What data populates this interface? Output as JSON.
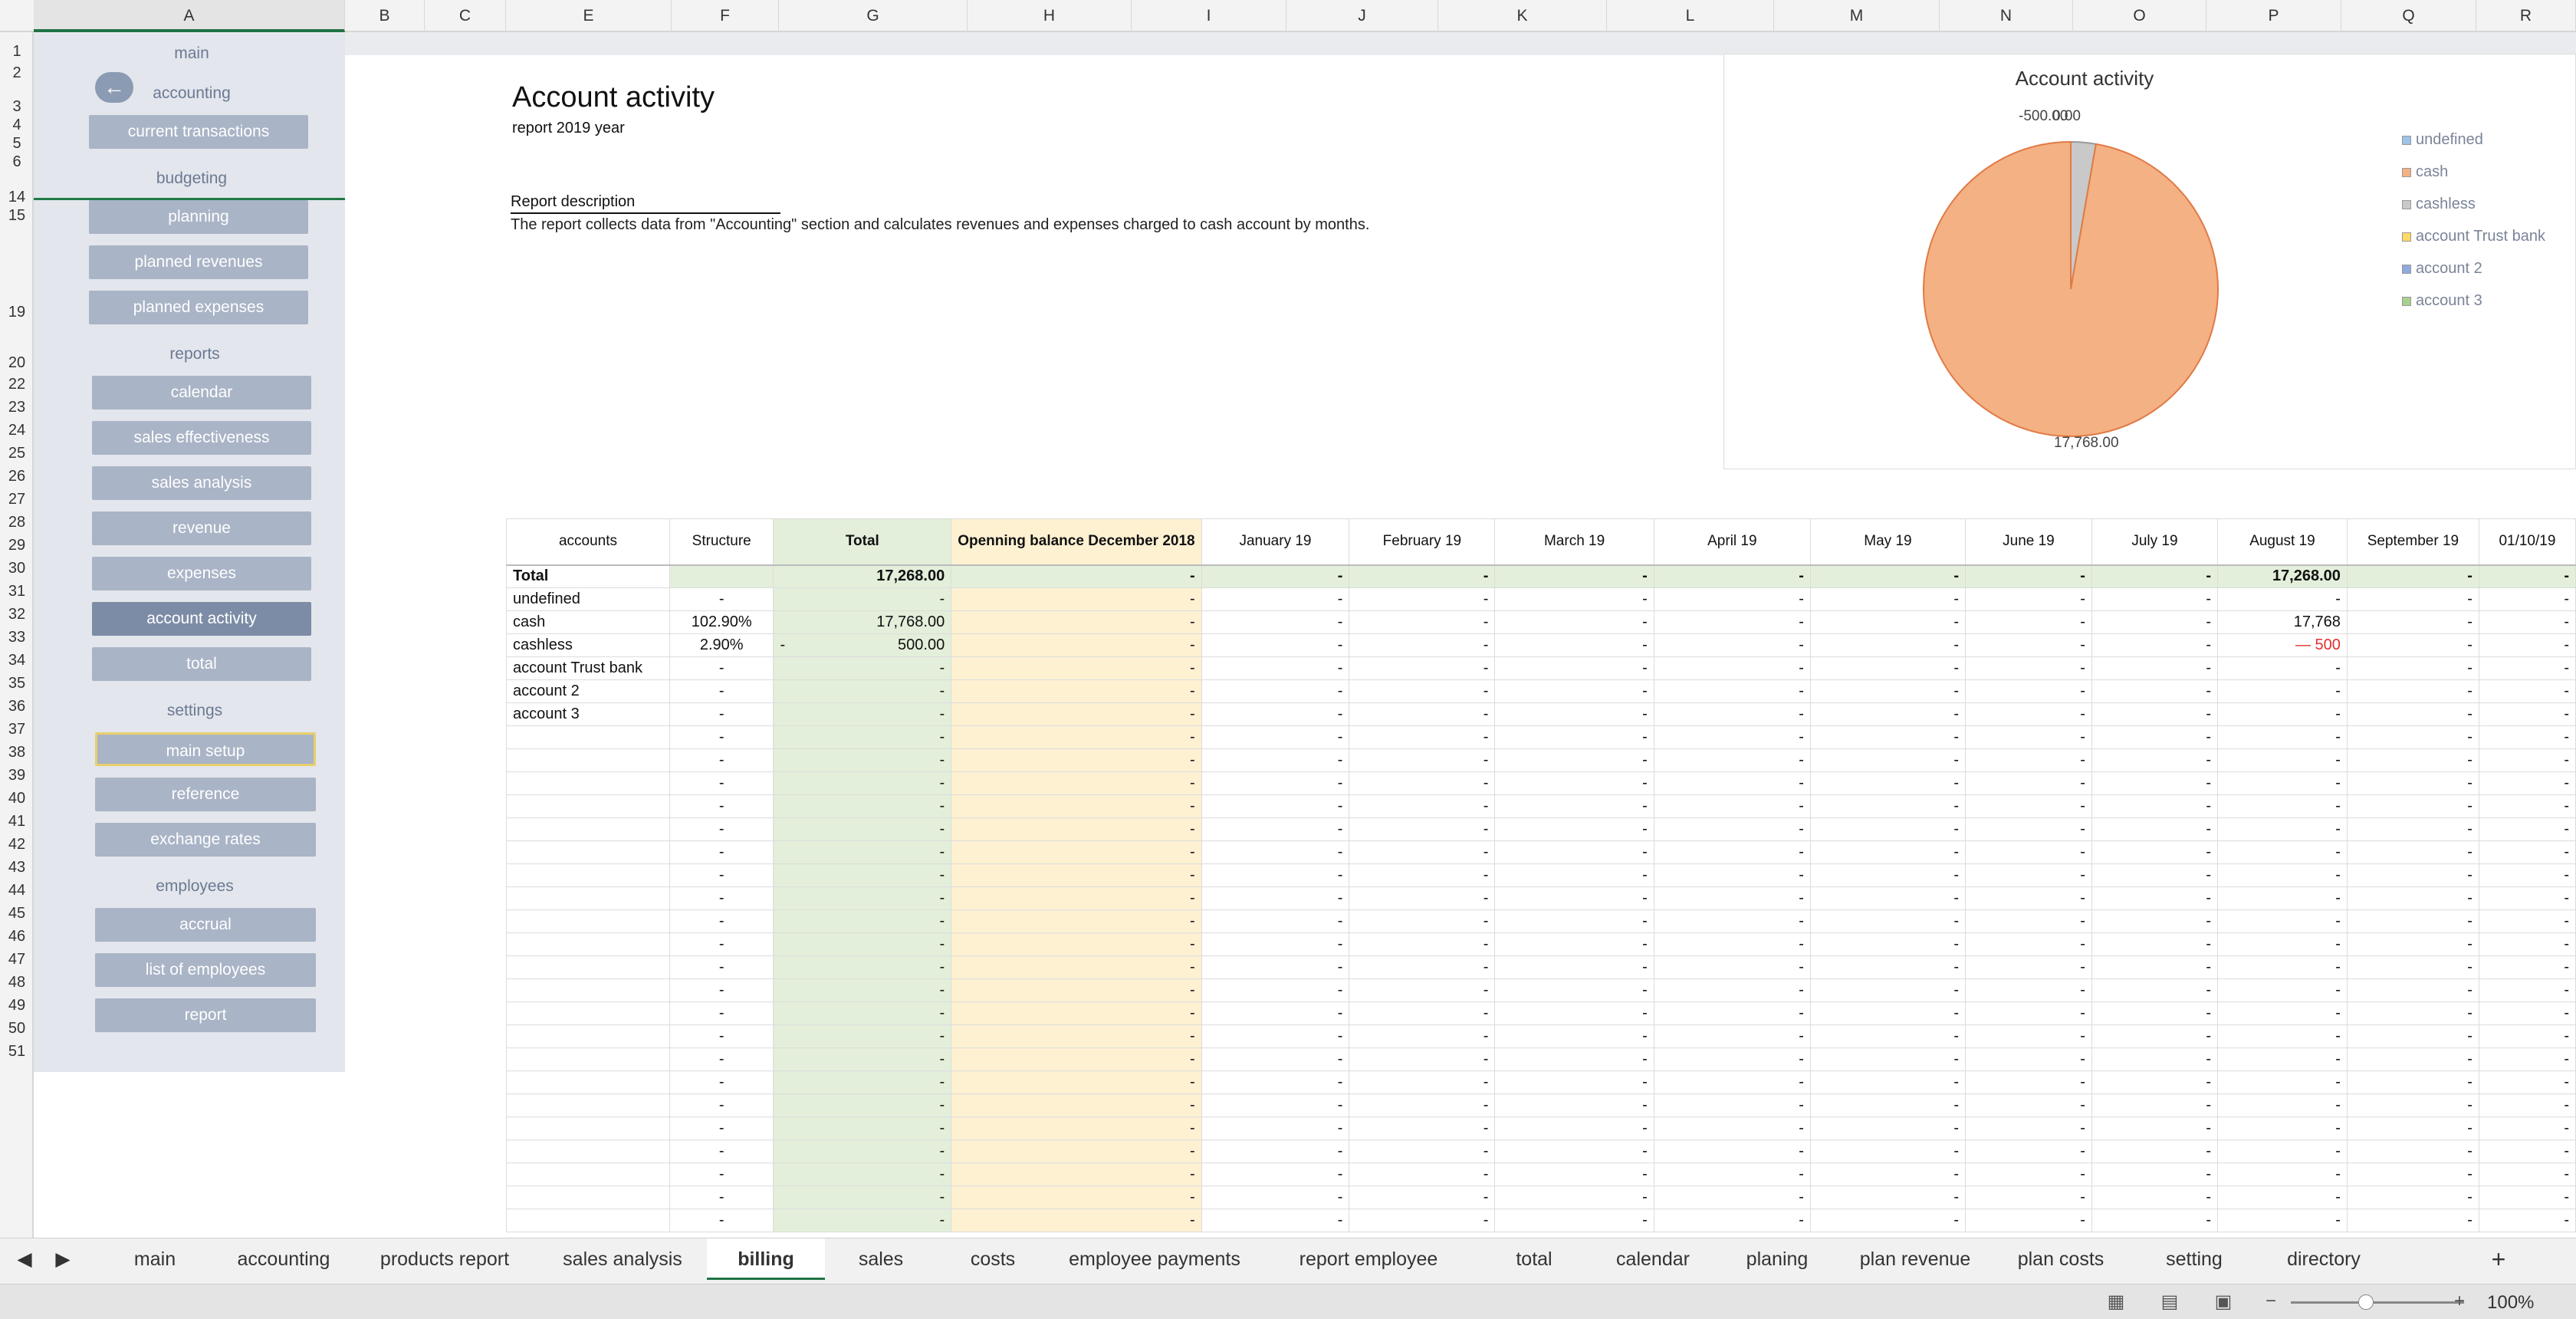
{
  "column_headers": [
    "A",
    "B",
    "C",
    "E",
    "F",
    "G",
    "H",
    "I",
    "J",
    "K",
    "L",
    "M",
    "N",
    "O",
    "P",
    "Q",
    "R"
  ],
  "row_headers": [
    "1",
    "2",
    "3",
    "4",
    "5",
    "6",
    "14",
    "15",
    "19",
    "20",
    "22",
    "23",
    "24",
    "25",
    "26",
    "27",
    "28",
    "29",
    "30",
    "31",
    "32",
    "33",
    "34",
    "35",
    "36",
    "37",
    "38",
    "39",
    "40",
    "41",
    "42",
    "43",
    "44",
    "45",
    "46",
    "47",
    "48",
    "49",
    "50",
    "51"
  ],
  "nav": {
    "back_icon": "arrow-left-icon",
    "main": "main",
    "sections": [
      {
        "title": "accounting",
        "items": [
          "current transactions"
        ]
      },
      {
        "title": "budgeting",
        "items": [
          "planning",
          "planned revenues",
          "planned expenses"
        ]
      },
      {
        "title": "reports",
        "items": [
          "calendar",
          "sales effectiveness",
          "sales analysis",
          "revenue",
          "expenses",
          "account activity",
          "total"
        ]
      },
      {
        "title": "settings",
        "items": [
          "main setup",
          "reference",
          "exchange rates"
        ]
      },
      {
        "title": "employees",
        "items": [
          "accrual",
          "list of employees",
          "report"
        ]
      }
    ],
    "active_item": "account activity"
  },
  "report": {
    "title": "Account activity",
    "subtitle": "report 2019 year",
    "description_heading": "Report description",
    "description_text": "The report collects data from \"Accounting\" section and calculates revenues and expenses charged to cash account by months."
  },
  "chart_data": {
    "type": "pie",
    "title": "Account activity",
    "categories": [
      "undefined",
      "cash",
      "cashless",
      "account Trust bank",
      "account 2",
      "account 3"
    ],
    "values": [
      0,
      17768,
      -500,
      0,
      0,
      0
    ],
    "data_labels": [
      "-500.00",
      "0.00",
      "17,768.00"
    ],
    "colors": [
      "#9dc3e6",
      "#f4b183",
      "#c9c9c9",
      "#ffd966",
      "#8faadc",
      "#a9d18e"
    ],
    "legend_position": "right"
  },
  "table": {
    "headers": [
      "accounts",
      "Structure",
      "Total",
      "Openning balance December 2018",
      "January 19",
      "February 19",
      "March 19",
      "April 19",
      "May 19",
      "June 19",
      "July 19",
      "August 19",
      "September 19",
      "01/10/19"
    ],
    "total_row": [
      "Total",
      "",
      "17,268.00",
      "-",
      "-",
      "-",
      "-",
      "-",
      "-",
      "-",
      "-",
      "17,268.00",
      "-",
      "-"
    ],
    "rows": [
      [
        "undefined",
        "-",
        "-",
        "-",
        "-",
        "-",
        "-",
        "-",
        "-",
        "-",
        "-",
        "-",
        "-",
        "-"
      ],
      [
        "cash",
        "102.90%",
        "17,768.00",
        "-",
        "-",
        "-",
        "-",
        "-",
        "-",
        "-",
        "-",
        "17,768",
        "-",
        "-"
      ],
      [
        "cashless",
        "2.90%",
        "500.00",
        "-",
        "-",
        "-",
        "-",
        "-",
        "-",
        "-",
        "-",
        "— 500",
        "-",
        "-"
      ],
      [
        "account Trust bank",
        "-",
        "-",
        "-",
        "-",
        "-",
        "-",
        "-",
        "-",
        "-",
        "-",
        "-",
        "-",
        "-"
      ],
      [
        "account 2",
        "-",
        "-",
        "-",
        "-",
        "-",
        "-",
        "-",
        "-",
        "-",
        "-",
        "-",
        "-",
        "-"
      ],
      [
        "account 3",
        "-",
        "-",
        "-",
        "-",
        "-",
        "-",
        "-",
        "-",
        "-",
        "-",
        "-",
        "-",
        "-"
      ]
    ],
    "cashless_total_prefix": "-",
    "empty_row": [
      "",
      "-",
      "-",
      "-",
      "-",
      "-",
      "-",
      "-",
      "-",
      "-",
      "-",
      "-",
      "-",
      "-"
    ],
    "empty_row_count": 22
  },
  "sheet_tabs": [
    "main",
    "accounting",
    "products report",
    "sales analysis",
    "billing",
    "sales",
    "costs",
    "employee payments",
    "report employee",
    "total",
    "calendar",
    "planing",
    "plan revenue",
    "plan costs",
    "setting",
    "directory"
  ],
  "active_tab": "billing",
  "add_sheet": "+",
  "status": {
    "zoom": "100%",
    "zoom_minus": "−",
    "zoom_plus": "+"
  }
}
